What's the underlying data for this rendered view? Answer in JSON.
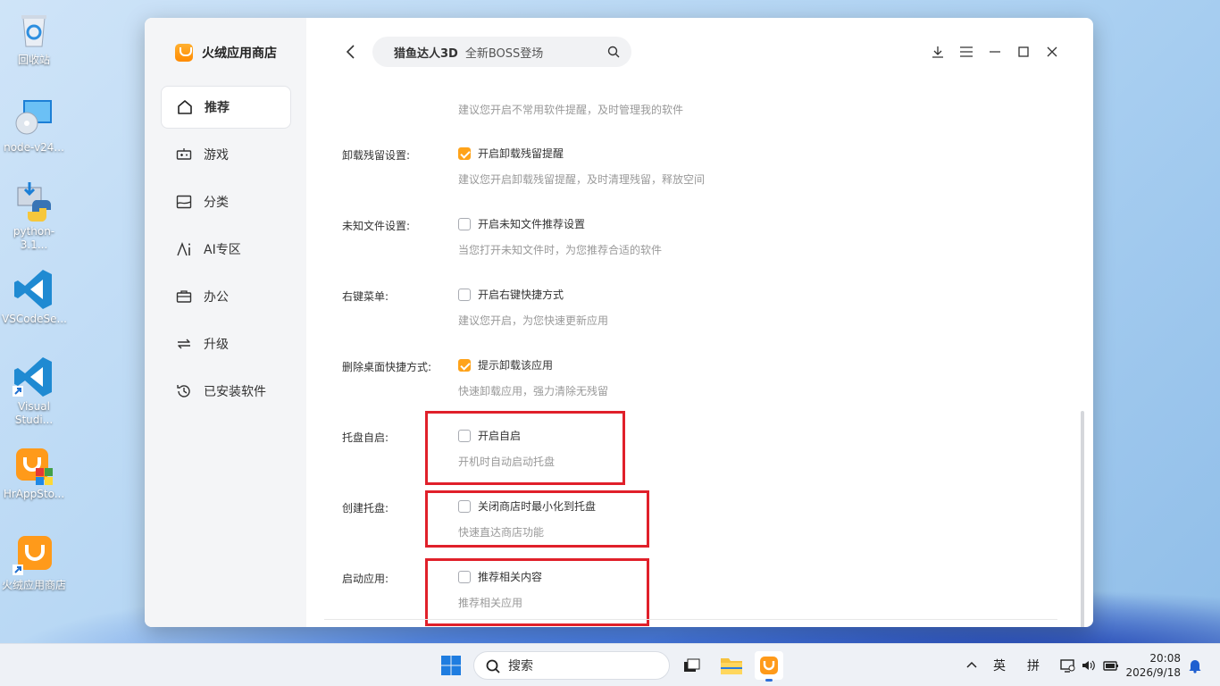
{
  "desktop": {
    "icons": [
      {
        "label": "回收站"
      },
      {
        "label": "node-v24..."
      },
      {
        "label": "python-3.1..."
      },
      {
        "label": "VSCodeSe..."
      },
      {
        "label": "Visual Studi..."
      },
      {
        "label": "HrAppSto..."
      },
      {
        "label": "火绒应用商店"
      }
    ]
  },
  "app": {
    "brand": "火绒应用商店",
    "nav": [
      {
        "label": "推荐",
        "icon": "home-icon",
        "active": true
      },
      {
        "label": "游戏",
        "icon": "gamepad-icon"
      },
      {
        "label": "分类",
        "icon": "category-icon"
      },
      {
        "label": "AI专区",
        "icon": "ai-icon"
      },
      {
        "label": "办公",
        "icon": "briefcase-icon"
      },
      {
        "label": "升级",
        "icon": "update-icon"
      },
      {
        "label": "已安装软件",
        "icon": "history-icon"
      }
    ],
    "search": {
      "hot": "猎鱼达人3D",
      "sub": "全新BOSS登场"
    },
    "settings": {
      "top_desc": "建议您开启不常用软件提醒，及时管理我的软件",
      "rows": [
        {
          "label": "卸载残留设置:",
          "option": "开启卸载残留提醒",
          "checked": true,
          "desc": "建议您开启卸载残留提醒，及时清理残留，释放空间"
        },
        {
          "label": "未知文件设置:",
          "option": "开启未知文件推荐设置",
          "checked": false,
          "desc": "当您打开未知文件时，为您推荐合适的软件"
        },
        {
          "label": "右键菜单:",
          "option": "开启右键快捷方式",
          "checked": false,
          "desc": "建议您开启，为您快速更新应用"
        },
        {
          "label": "删除桌面快捷方式:",
          "option": "提示卸载该应用",
          "checked": true,
          "desc": "快速卸载应用，强力清除无残留"
        },
        {
          "label": "托盘自启:",
          "option": "开启自启",
          "checked": false,
          "desc": "开机时自动启动托盘"
        },
        {
          "label": "创建托盘:",
          "option": "关闭商店时最小化到托盘",
          "checked": false,
          "desc": "快速直达商店功能"
        },
        {
          "label": "启动应用:",
          "option": "推荐相关内容",
          "checked": false,
          "desc": "推荐相关应用"
        }
      ]
    }
  },
  "taskbar": {
    "search_label": "搜索",
    "ime_lang": "英",
    "ime_mode": "拼",
    "time": "20:08",
    "date": "2026/9/18"
  },
  "colors": {
    "accent": "#ffa31a",
    "highlight_border": "#e0202a"
  }
}
